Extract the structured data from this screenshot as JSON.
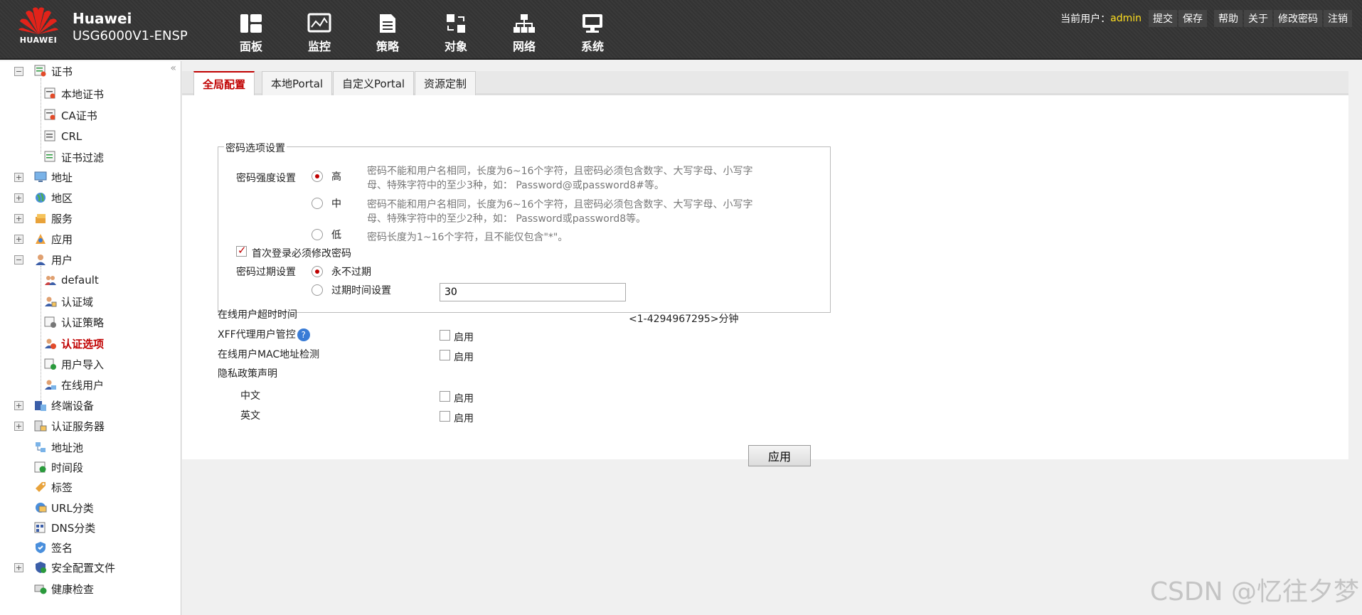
{
  "header": {
    "logo_text": "HUAWEI",
    "brand_line1": "Huawei",
    "brand_line2": "USG6000V1-ENSP",
    "nav": [
      {
        "label": "面板",
        "icon": "dashboard-icon"
      },
      {
        "label": "监控",
        "icon": "monitor-icon"
      },
      {
        "label": "策略",
        "icon": "policy-icon"
      },
      {
        "label": "对象",
        "icon": "object-icon"
      },
      {
        "label": "网络",
        "icon": "network-icon"
      },
      {
        "label": "系统",
        "icon": "system-icon"
      }
    ],
    "current_user_label": "当前用户：",
    "current_user": "admin",
    "links": [
      "提交",
      "保存",
      "帮助",
      "关于",
      "修改密码",
      "注销"
    ]
  },
  "sidebar": {
    "collapse": "«",
    "items": [
      {
        "label": "证书",
        "expander": "−"
      },
      {
        "label": "本地证书"
      },
      {
        "label": "CA证书"
      },
      {
        "label": "CRL"
      },
      {
        "label": "证书过滤"
      },
      {
        "label": "地址",
        "expander": "+"
      },
      {
        "label": "地区",
        "expander": "+"
      },
      {
        "label": "服务",
        "expander": "+"
      },
      {
        "label": "应用",
        "expander": "+"
      },
      {
        "label": "用户",
        "expander": "−"
      },
      {
        "label": "default"
      },
      {
        "label": "认证域"
      },
      {
        "label": "认证策略"
      },
      {
        "label": "认证选项"
      },
      {
        "label": "用户导入"
      },
      {
        "label": "在线用户"
      },
      {
        "label": "终端设备",
        "expander": "+"
      },
      {
        "label": "认证服务器",
        "expander": "+"
      },
      {
        "label": "地址池"
      },
      {
        "label": "时间段"
      },
      {
        "label": "标签"
      },
      {
        "label": "URL分类"
      },
      {
        "label": "DNS分类"
      },
      {
        "label": "签名"
      },
      {
        "label": "安全配置文件",
        "expander": "+"
      },
      {
        "label": "健康检查"
      }
    ]
  },
  "tabs": [
    "全局配置",
    "本地Portal",
    "自定义Portal",
    "资源定制"
  ],
  "form": {
    "fieldset_legend": "密码选项设置",
    "strength_label": "密码强度设置",
    "strength_high": "高",
    "strength_high_desc": "密码不能和用户名相同，长度为6~16个字符，且密码必须包含数字、大写字母、小写字母、特殊字符中的至少3种，如： Password@或password8#等。",
    "strength_mid": "中",
    "strength_mid_desc": "密码不能和用户名相同，长度为6~16个字符，且密码必须包含数字、大写字母、小写字母、特殊字符中的至少2种，如： Password或password8等。",
    "strength_low": "低",
    "strength_low_desc": "密码长度为1~16个字符，且不能仅包含\"*\"。",
    "first_login_label": "首次登录必须修改密码",
    "expire_label": "密码过期设置",
    "expire_never": "永不过期",
    "expire_time": "过期时间设置",
    "timeout_label": "在线用户超时时间",
    "timeout_value": "30",
    "timeout_range": "<1-4294967295>分钟",
    "xff_label": "XFF代理用户管控",
    "help_glyph": "?",
    "mac_label": "在线用户MAC地址检测",
    "privacy_label": "隐私政策声明",
    "privacy_cn": "中文",
    "privacy_en": "英文",
    "enable": "启用",
    "apply": "应用"
  },
  "watermark": "CSDN @忆往夕梦"
}
